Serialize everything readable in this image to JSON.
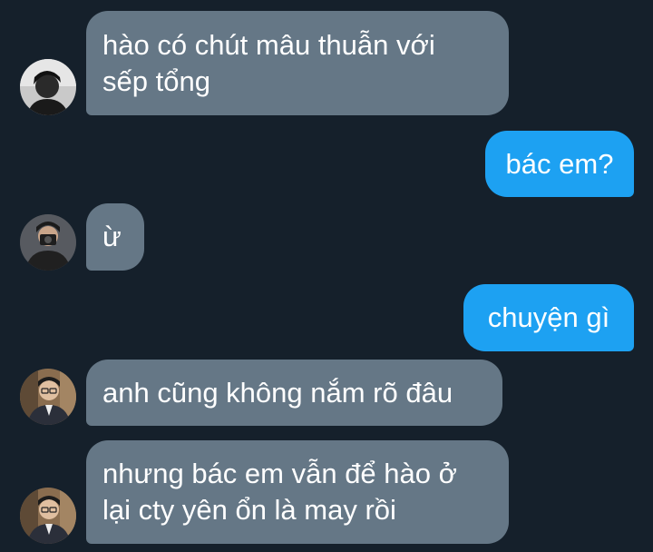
{
  "conversation": {
    "messages": [
      {
        "sender": "other",
        "lines": [
          "hào có chút mâu thuẫn với",
          "sếp tổng"
        ],
        "avatar": "avatar-bw-portrait"
      },
      {
        "sender": "self",
        "lines": [
          "bác em?"
        ]
      },
      {
        "sender": "other",
        "lines": [
          "ừ"
        ],
        "avatar": "avatar-camera-selfie"
      },
      {
        "sender": "self",
        "lines": [
          "chuyện gì"
        ]
      },
      {
        "sender": "other",
        "lines": [
          "anh cũng không nắm rõ đâu"
        ],
        "avatar": "avatar-suit-glasses"
      },
      {
        "sender": "other",
        "lines": [
          "nhưng bác em vẫn để hào ở",
          "lại cty yên ổn là may rồi"
        ],
        "avatar": "avatar-suit-glasses"
      }
    ]
  },
  "colors": {
    "background": "#15202b",
    "incoming_bubble": "#657786",
    "outgoing_bubble": "#1da1f2",
    "text": "#ffffff"
  }
}
